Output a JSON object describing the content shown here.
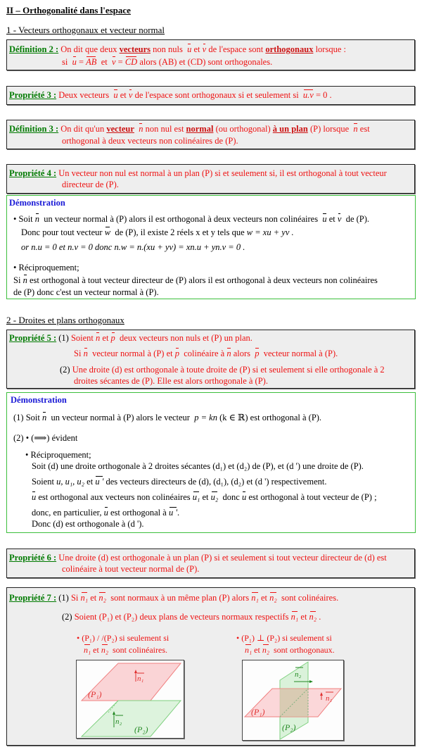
{
  "title": "II – Orthogonalité dans l'espace",
  "section1": "1 - Vecteurs orthogonaux et vecteur normal",
  "def2": {
    "label": "Définition 2 :",
    "l1a": "On dit que deux",
    "l1b": "vecteurs",
    "l1c": "non nuls",
    "u": "u",
    "et": "et",
    "v": "v",
    "l1d": "de l'espace sont",
    "l1e": "orthogonaux",
    "l1f": "lorsque :",
    "l2a": "si",
    "l2eq1": "=",
    "AB": "AB",
    "l2et": "et",
    "l2eq2": "=",
    "CD": "CD",
    "l2b": "alors (AB) et (CD) sont orthogonales."
  },
  "prop3": {
    "label": "Propriété 3 :",
    "a": "Deux vecteurs",
    "u": "u",
    "et": "et",
    "v": "v",
    "b": "de l'espace sont orthogonaux si et seulement si",
    "dot": "u.v",
    "c": "= 0 ."
  },
  "def3": {
    "label": "Définition 3 :",
    "a": "On dit qu'un",
    "b": "vecteur",
    "n": "n",
    "c": "non nul est",
    "d": "normal",
    "e": "(ou orthogonal)",
    "f": "à un plan",
    "g": "(P) lorsque",
    "n2": "n",
    "h": "est",
    "l2": "orthogonal à deux vecteurs non colinéaires de (P)."
  },
  "prop4": {
    "label": "Propriété 4 :",
    "l1": "Un vecteur non nul est normal à un plan (P) si et seulement si, il est orthogonal à tout vecteur",
    "l2": "directeur de (P)."
  },
  "demo1": {
    "title": "Démonstration",
    "l1a": "• Soit",
    "n": "n",
    "l1b": "un vecteur normal à (P) alors il est orthogonal à deux vecteurs non colinéaires",
    "u": "u",
    "et": "et",
    "v": "v",
    "l1c": "de (P).",
    "l2a": "Donc pour tout vecteur",
    "w": "w",
    "l2b": "de (P), il existe 2 réels x et y tels que",
    "l2eq": "w = xu + yv .",
    "l3": "or  n.u = 0   et   n.v = 0   donc   n.w = n.(xu + yv) = xn.u + yn.v = 0 .",
    "l4": "• Réciproquement;",
    "l5a": "Si",
    "l5n": "n",
    "l5b": "est orthogonal à tout vecteur directeur de (P) alors il est orthogonal à deux vecteurs non colinéaires",
    "l6": "de (P) donc c'est un vecteur normal à (P)."
  },
  "section2": "2 - Droites et plans orthogonaux",
  "prop5": {
    "label": "Propriété 5 :",
    "l1num": "(1)",
    "l1a": "Soient",
    "n": "n",
    "et": "et",
    "p": "p",
    "l1b": "deux vecteurs non nuls et (P) un plan.",
    "l2a": "Si",
    "l2b": "vecteur normal à (P) et",
    "l2c": "colinéaire à",
    "l2d": "alors",
    "l2e": "vecteur normal à (P).",
    "l3num": "(2)",
    "l3": "Une droite (d) est orthogonale à toute droite de (P) si et seulement si elle orthogonale à 2",
    "l4": "droites sécantes de (P). Elle est alors orthogonale à (P)."
  },
  "demo2": {
    "title": "Démonstration",
    "l1a": "(1) Soit",
    "n": "n",
    "l1b": "un vecteur normal à (P) alors le vecteur",
    "l1eq": "p = kn",
    "l1c": "(k ∈ ℝ) est orthogonal à (P).",
    "l2": "(2) • (⟹) évident",
    "l3": "• Réciproquement;",
    "l4": "Soit (d) une droite orthogonale à 2 droites sécantes (d₁) et (d₂) de (P), et (d ') une droite de (P).",
    "l5a": "Soient",
    "l5v": "u, u₁, u₂",
    "l5et": "et",
    "l5u": "u '",
    "l5b": "des vecteurs directeurs de (d), (d₁), (d₂) et (d ')  respectivement.",
    "l6a": "u",
    "l6b": "est orthogonal aux vecteurs non colinéaires",
    "l6c": "u₁",
    "l6d": "et",
    "l6e": "u₂",
    "l6f": "donc",
    "l6g": "u",
    "l6h": "est orthogonal à tout vecteur de (P) ;",
    "l7a": "donc, en particulier,",
    "l7b": "u",
    "l7c": "est orthogonal à",
    "l7d": "u '",
    "l7e": ".",
    "l8": "Donc (d) est orthogonale à  (d ')."
  },
  "prop6": {
    "label": "Propriété 6 :",
    "l1": "Une droite (d) est orthogonale à un plan (P) si et seulement si tout vecteur directeur de (d) est",
    "l2": "colinéaire à tout vecteur normal de (P)."
  },
  "prop7": {
    "label": "Propriété 7 :",
    "l1num": "(1)",
    "l1a": "Si",
    "n1": "n₁",
    "et": "et",
    "n2": "n₂",
    "l1b": "sont normaux à un même plan (P) alors",
    "l1c": "sont colinéaires.",
    "l2num": "(2)",
    "l2a": "Soient  (P₁) et (P₂)  deux plans de vecteurs normaux respectifs",
    "l2b": ".",
    "left": {
      "l1": "• (P₁) / /(P₂) si seulement si",
      "l2b": "sont colinéaires."
    },
    "right": {
      "l1": "• (P₁) ⊥ (P₂) si seulement si",
      "l2b": "sont orthogonaux."
    },
    "fig": {
      "p1": "(P₁)",
      "p2": "(P₂)",
      "n1": "n₁",
      "n2": "n₂"
    }
  },
  "colors": {
    "label_green": "#007a00",
    "text_red": "#ee1111",
    "demo_blue": "#1a1ad6",
    "demo_border": "#3cbf3c",
    "box_bg": "#eeeeee",
    "plane_red": "#f08080",
    "plane_green": "#7fd07f"
  }
}
